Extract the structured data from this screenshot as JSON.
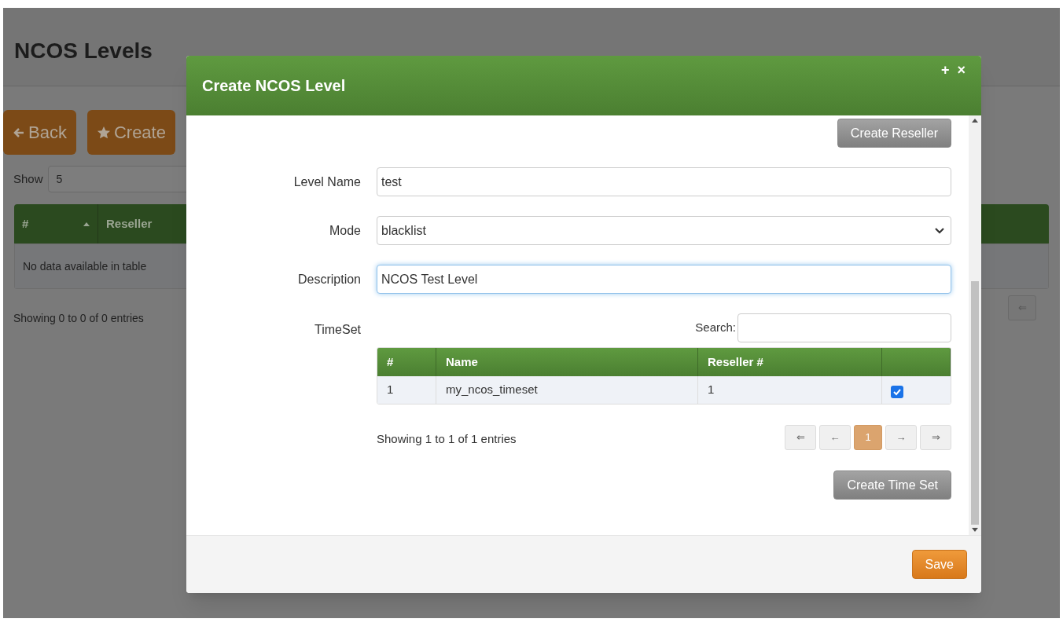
{
  "page": {
    "title": "NCOS Levels",
    "buttons": [
      {
        "kind": "back",
        "label": "Back"
      },
      {
        "kind": "create",
        "label": "Create"
      }
    ],
    "show_label": "Show",
    "page_size": "5",
    "table": {
      "columns": [
        {
          "label": "#",
          "sorted": true
        },
        {
          "label": "Reseller",
          "sorted": false
        }
      ],
      "empty_message": "No data available in table"
    },
    "info": "Showing 0 to 0 of 0 entries",
    "pagination": [
      {
        "label": "⇐"
      }
    ]
  },
  "modal": {
    "title": "Create NCOS Level",
    "header_controls": [
      "+",
      "×"
    ],
    "create_reseller": "Create Reseller",
    "fields": [
      {
        "kind": "text",
        "label": "Level Name",
        "value": "test",
        "focused": false
      },
      {
        "kind": "select",
        "label": "Mode",
        "value": "blacklist",
        "focused": false
      },
      {
        "kind": "text",
        "label": "Description",
        "value": "NCOS Test Level",
        "focused": true
      }
    ],
    "timeset": {
      "label": "TimeSet",
      "search_label": "Search:",
      "columns": [
        "#",
        "Name",
        "Reseller #"
      ],
      "rows": [
        {
          "cells": [
            "1",
            "my_ncos_timeset",
            "1"
          ],
          "checked": true
        }
      ],
      "info": "Showing 1 to 1 of 1 entries",
      "pagination": [
        {
          "label": "⇐",
          "selected": false
        },
        {
          "label": "←",
          "selected": false
        },
        {
          "label": "1",
          "selected": true
        },
        {
          "label": "→",
          "selected": false
        },
        {
          "label": "⇒",
          "selected": false
        }
      ],
      "create_button": "Create Time Set"
    },
    "save": "Save"
  }
}
